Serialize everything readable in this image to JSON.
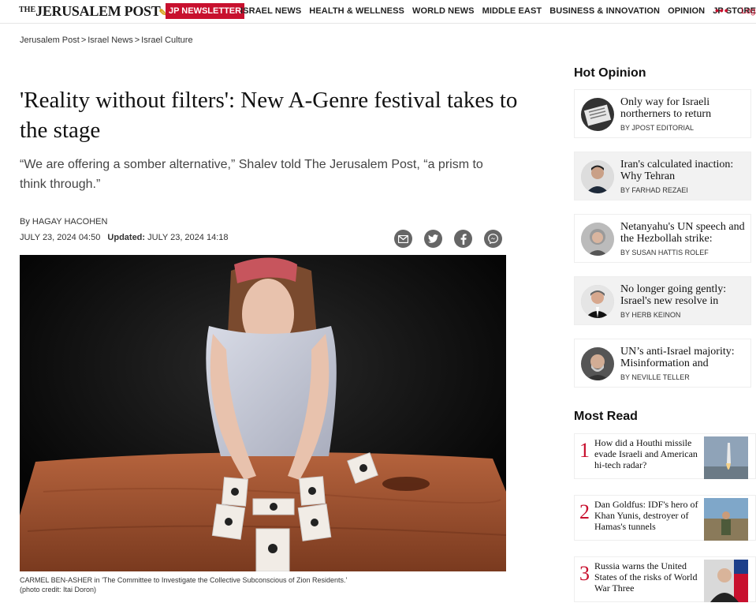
{
  "header": {
    "logo_the": "THE",
    "logo_text": "JERUSALEM POST",
    "newsletter_label": "JP NEWSLETTER",
    "nav": [
      "ISRAEL NEWS",
      "HEALTH & WELLNESS",
      "WORLD NEWS",
      "MIDDLE EAST",
      "BUSINESS & INNOVATION",
      "OPINION",
      "JP STORE"
    ],
    "more_label": "•••",
    "login_label": "Login"
  },
  "breadcrumb": [
    "Jerusalem Post",
    "Israel News",
    "Israel Culture"
  ],
  "article": {
    "headline": "'Reality without filters': New A-Genre festival takes to the stage",
    "subhead": "“We are offering a somber alternative,” Shalev told The Jerusalem Post, “a prism to think through.”",
    "byline_prefix": "By",
    "author": "HAGAY HACOHEN",
    "published": "JULY 23, 2024 04:50",
    "updated_label": "Updated:",
    "updated": "JULY 23, 2024 14:18",
    "caption": "CARMEL BEN-ASHER in 'The Committee to Investigate the Collective Subconscious of Zion Residents.'",
    "photo_credit": "(photo credit: Itai Doron)"
  },
  "share_icons": [
    "email-icon",
    "twitter-icon",
    "facebook-icon",
    "messenger-icon"
  ],
  "sidebar": {
    "hot_opinion_title": "Hot Opinion",
    "hot_opinion": [
      {
        "title": "Only way for Israeli northerners to return",
        "author": "By JPOST EDITORIAL"
      },
      {
        "title": "Iran's calculated inaction: Why Tehran",
        "author": "By FARHAD REZAEI"
      },
      {
        "title": "Netanyahu's UN speech and the Hezbollah strike:",
        "author": "By SUSAN HATTIS ROLEF"
      },
      {
        "title": "No longer going gently: Israel's new resolve in",
        "author": "By HERB KEINON"
      },
      {
        "title": "UN’s anti-Israel majority: Misinformation and",
        "author": "By NEVILLE TELLER"
      }
    ],
    "most_read_title": "Most Read",
    "most_read": [
      {
        "num": "1",
        "title": "How did a Houthi missile evade Israeli and American hi-tech radar?"
      },
      {
        "num": "2",
        "title": "Dan Goldfus: IDF's hero of Khan Yunis, destroyer of Hamas's tunnels"
      },
      {
        "num": "3",
        "title": "Russia warns the United States of the risks of World War Three"
      }
    ]
  },
  "colors": {
    "brand_red": "#c8102e",
    "share_gray": "#666666"
  }
}
